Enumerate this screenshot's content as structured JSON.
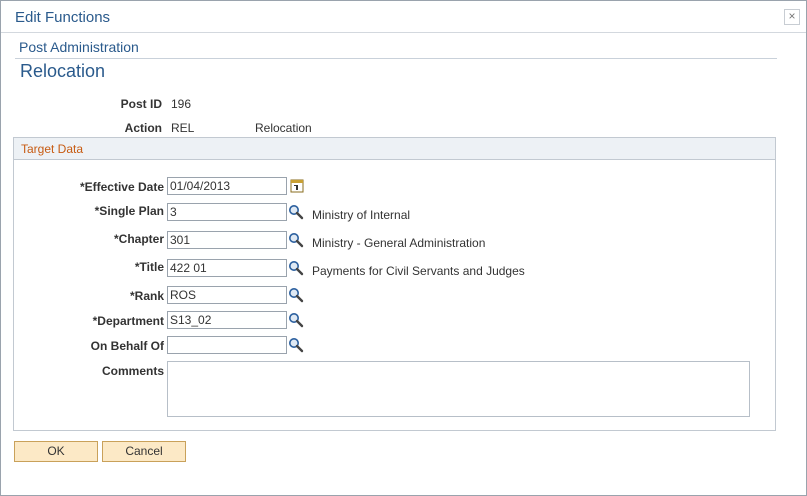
{
  "dialog": {
    "title": "Edit Functions",
    "close_glyph": "×"
  },
  "header": {
    "section": "Post Administration",
    "page_title": "Relocation"
  },
  "summary": {
    "post_id_label": "Post ID",
    "post_id_value": "196",
    "action_label": "Action",
    "action_code": "REL",
    "action_desc": "Relocation"
  },
  "target": {
    "title": "Target Data",
    "effective_date": {
      "label": "*Effective Date",
      "value": "01/04/2013"
    },
    "single_plan": {
      "label": "*Single Plan",
      "value": "3",
      "desc": "Ministry of Internal"
    },
    "chapter": {
      "label": "*Chapter",
      "value": "301",
      "desc": "Ministry - General Administration"
    },
    "title_field": {
      "label": "*Title",
      "value": "422 01",
      "desc": "Payments for Civil Servants and Judges"
    },
    "rank": {
      "label": "*Rank",
      "value": "ROS"
    },
    "department": {
      "label": "*Department",
      "value": "S13_02"
    },
    "on_behalf_of": {
      "label": "On Behalf Of",
      "value": ""
    },
    "comments": {
      "label": "Comments",
      "value": ""
    }
  },
  "buttons": {
    "ok": "OK",
    "cancel": "Cancel"
  },
  "colors": {
    "title_blue": "#2a5a8c",
    "group_orange": "#c75b12",
    "button_fill": "#fce9c6"
  }
}
